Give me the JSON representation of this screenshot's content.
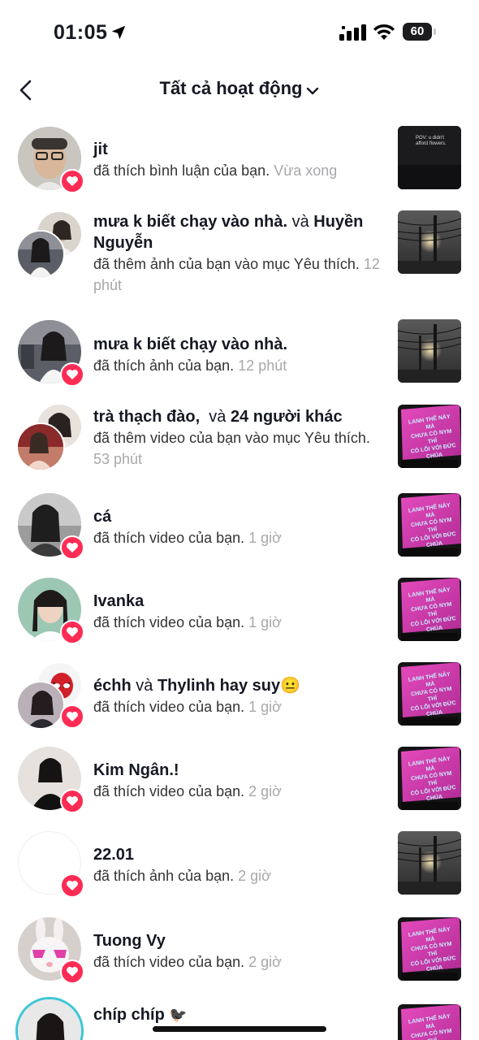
{
  "status_bar": {
    "time": "01:05",
    "battery": "60"
  },
  "header": {
    "title": "Tất cả hoạt động"
  },
  "notifications": [
    {
      "names": "jit",
      "conj": "",
      "names2": "",
      "action": "đã thích bình luận của bạn.",
      "time": "Vừa xong"
    },
    {
      "names": "mưa k biết chạy vào nhà.",
      "conj": " và ",
      "names2": "Huyền Nguyễn",
      "action": "đã thêm ảnh của bạn vào mục Yêu thích.",
      "time": "12 phút"
    },
    {
      "names": "mưa k biết chạy vào nhà.",
      "conj": "",
      "names2": "",
      "action": "đã thích ảnh của bạn.",
      "time": "12 phút"
    },
    {
      "names": "trà thạch đào,",
      "conj": "  và ",
      "names2": "24 người khác",
      "action": "đã thêm video của bạn vào mục Yêu thích.",
      "time": "53 phút"
    },
    {
      "names": "cá",
      "conj": "",
      "names2": "",
      "action": "đã thích video của bạn.",
      "time": "1 giờ"
    },
    {
      "names": "Ivanka",
      "conj": "",
      "names2": "",
      "action": "đã thích video của bạn.",
      "time": "1 giờ"
    },
    {
      "names": "échh",
      "conj": " và ",
      "names2": "Thylinh hay suy😐",
      "action": "đã thích video của bạn.",
      "time": "1 giờ"
    },
    {
      "names": "Kim Ngân.!",
      "conj": "",
      "names2": "",
      "action": "đã thích video của bạn.",
      "time": "2 giờ"
    },
    {
      "names": "22.01",
      "conj": "",
      "names2": "",
      "action": "đã thích ảnh của bạn.",
      "time": "2 giờ"
    },
    {
      "names": "Tuong Vy",
      "conj": "",
      "names2": "",
      "action": "đã thích video của bạn.",
      "time": "2 giờ"
    },
    {
      "names": "chíp chíp",
      "conj": "",
      "names2": "",
      "action": "",
      "time": ""
    }
  ],
  "thumbs": {
    "pov_caption": "POV: u didn't afford flowers.",
    "billboard_lines": [
      "LANH THẾ NÀY MÀ",
      "CHƯA CÓ NYM THÌ",
      "CÓ LỖI VỚI ĐỨC CHÚA"
    ]
  },
  "colors": {
    "accent": "#fe2c55",
    "timestamp": "#a8a8ab",
    "billboard": "#d63fb0"
  }
}
